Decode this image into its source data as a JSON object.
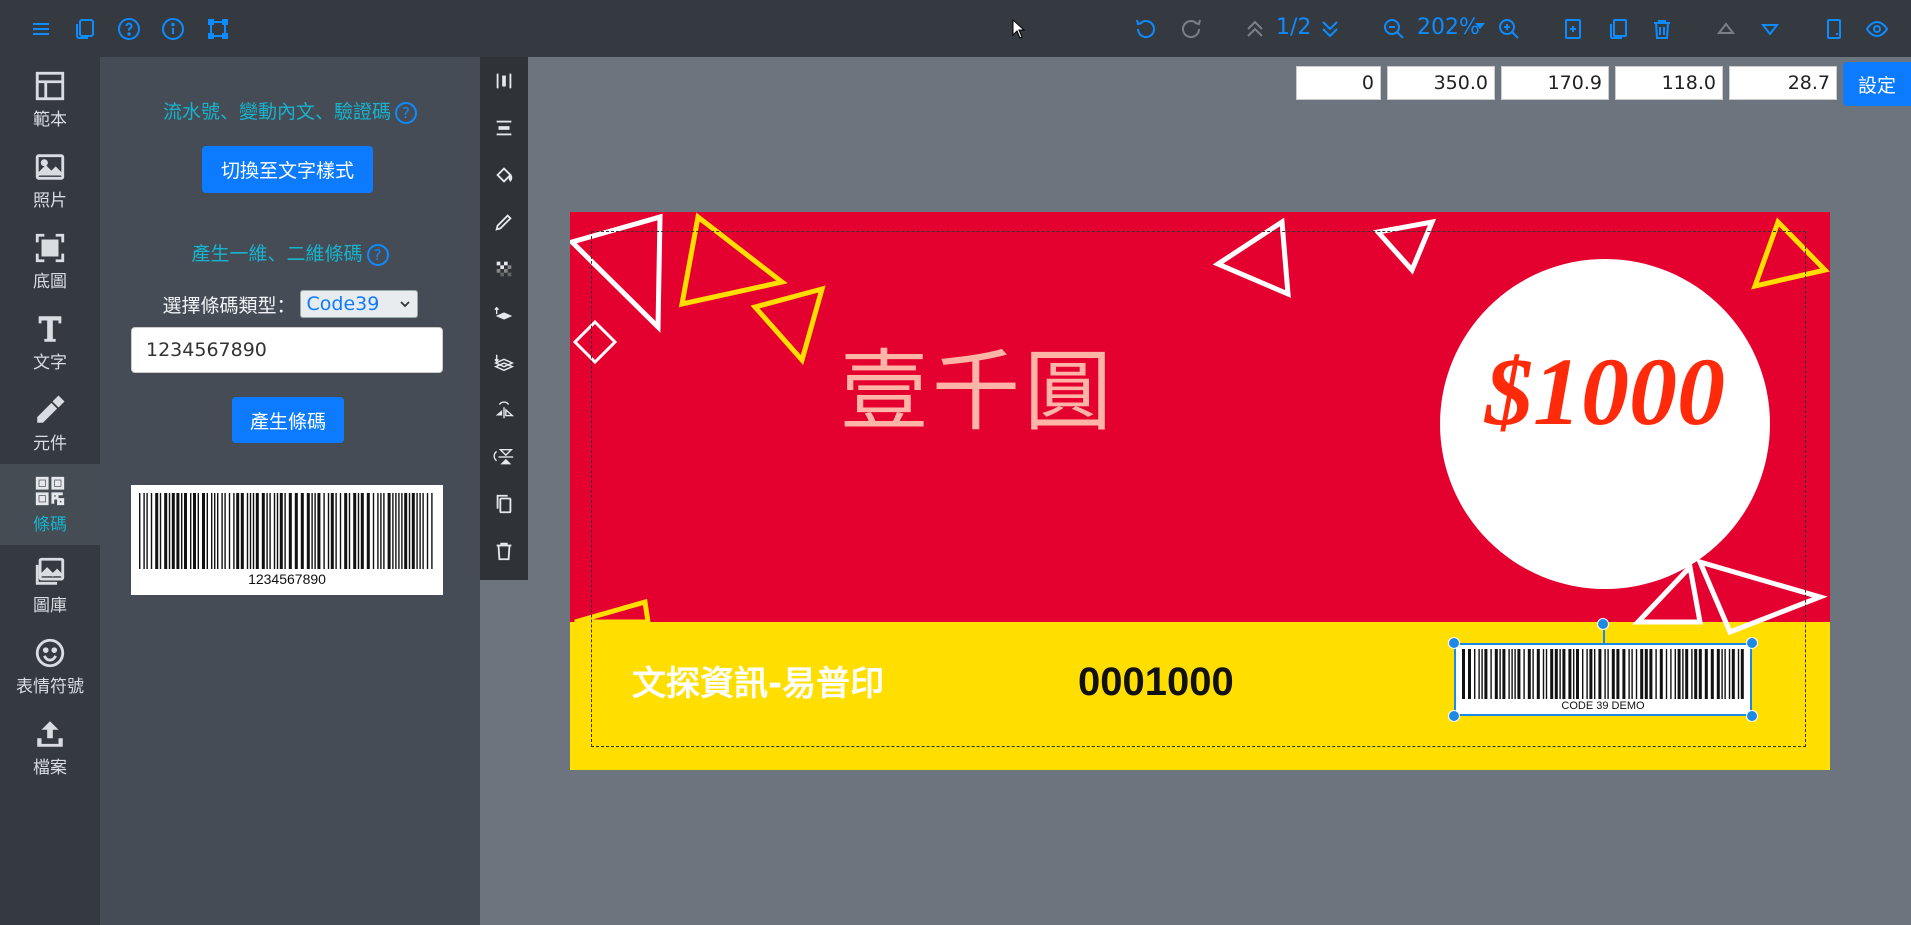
{
  "toolbar": {
    "page_indicator": "1/2",
    "zoom_level": "202%",
    "icons": [
      "menu-icon",
      "pages-icon",
      "help-icon",
      "info-icon",
      "crop-icon",
      "undo-icon",
      "redo-icon",
      "page-up-icon",
      "page-down-icon",
      "zoom-out-icon",
      "zoom-dropdown-icon",
      "zoom-in-icon",
      "add-page-icon",
      "duplicate-page-icon",
      "delete-page-icon",
      "move-up-icon",
      "move-down-icon",
      "page-orientation-icon",
      "preview-icon"
    ]
  },
  "sidebar": {
    "items": [
      {
        "label": "範本",
        "icon": "template-icon"
      },
      {
        "label": "照片",
        "icon": "photo-icon"
      },
      {
        "label": "底圖",
        "icon": "background-icon"
      },
      {
        "label": "文字",
        "icon": "text-icon"
      },
      {
        "label": "元件",
        "icon": "component-icon"
      },
      {
        "label": "條碼",
        "icon": "barcode-icon"
      },
      {
        "label": "圖庫",
        "icon": "gallery-icon"
      },
      {
        "label": "表情符號",
        "icon": "emoji-icon"
      },
      {
        "label": "檔案",
        "icon": "upload-icon"
      }
    ],
    "active": "條碼"
  },
  "panel": {
    "serial_title": "流水號、變動內文、驗證碼",
    "switch_text_button": "切換至文字樣式",
    "barcode_title": "產生一維、二維條碼",
    "barcode_type_label": "選擇條碼類型：",
    "barcode_type_value": "Code39",
    "barcode_input_value": "1234567890",
    "generate_button": "產生條碼",
    "preview_text": "1234567890"
  },
  "coords": {
    "values": [
      "0",
      "350.0",
      "170.9",
      "118.0",
      "28.7"
    ],
    "set_button": "設定"
  },
  "design": {
    "title_text": "壹千圓",
    "amount_text": "$1000",
    "company_text": "文探資訊-易普印",
    "serial_text": "0001000",
    "barcode_caption": "CODE 39 DEMO"
  },
  "colors": {
    "accent": "#0d7bff",
    "teal": "#17b3cc",
    "red": "#e4002f",
    "yellow": "#ffde00",
    "amount": "#ff2a0a"
  }
}
